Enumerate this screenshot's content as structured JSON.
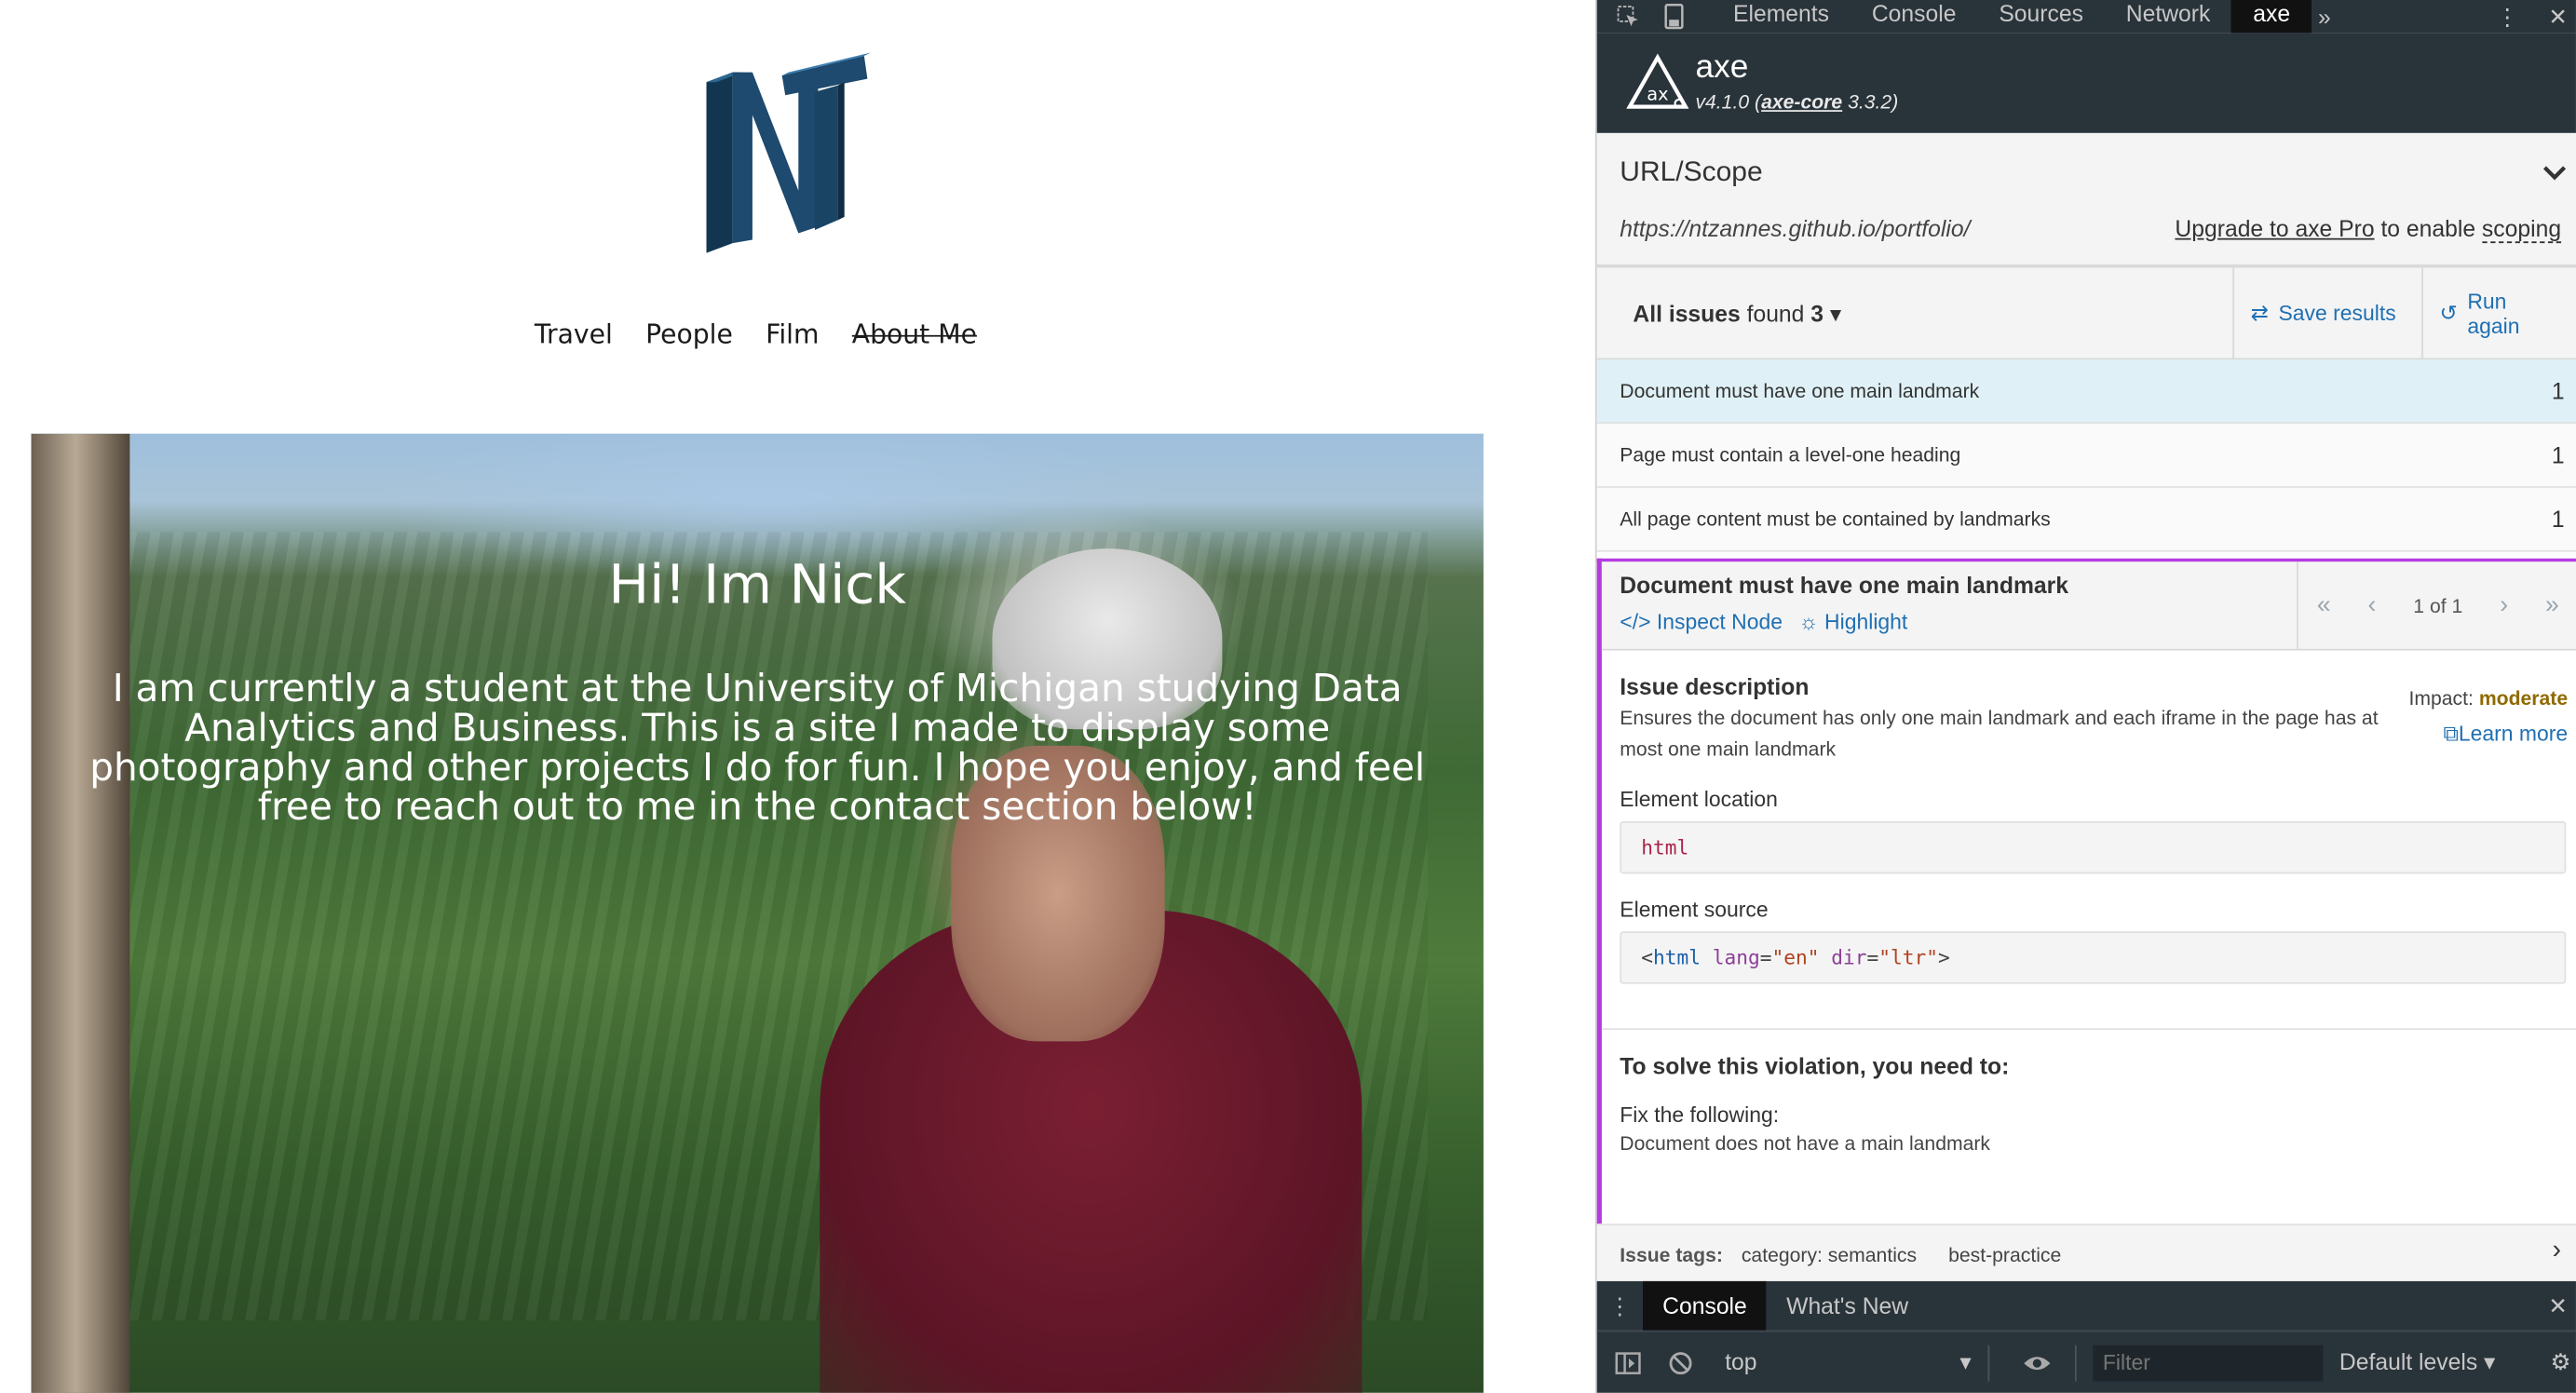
{
  "site": {
    "nav": [
      "Travel",
      "People",
      "Film",
      "About Me"
    ],
    "hero_title": "Hi! Im Nick",
    "hero_text": "I am currently a student at the University of Michigan studying Data Analytics and Business. This is a site I made to display some photography and other projects I do for fun. I hope you enjoy, and feel free to reach out to me in the contact section below!",
    "logo_letters": "NT",
    "logo_color": "#1d4a6e"
  },
  "devtools": {
    "tabs": [
      "Elements",
      "Console",
      "Sources",
      "Network",
      "axe"
    ],
    "active_tab": "axe",
    "icons": [
      "inspect-element-icon",
      "device-toolbar-icon",
      "more-tabs-icon",
      "kebab-menu-icon",
      "close-icon"
    ],
    "axe": {
      "name": "axe",
      "version": "v4.1.0",
      "core_label": "axe-core",
      "core_version": "3.3.2",
      "scope_title": "URL/Scope",
      "url": "https://ntzannes.github.io/portfolio/",
      "upgrade_link": "Upgrade to axe Pro",
      "upgrade_rest": "to enable",
      "upgrade_scoping": "scoping",
      "issues_label": "All issues",
      "issues_found": "found",
      "issues_count": "3",
      "save_results": "Save results",
      "run_again": "Run again",
      "issues": [
        {
          "label": "Document must have one main landmark",
          "count": "1",
          "selected": true
        },
        {
          "label": "Page must contain a level-one heading",
          "count": "1",
          "selected": false
        },
        {
          "label": "All page content must be contained by landmarks",
          "count": "1",
          "selected": false
        }
      ],
      "detail": {
        "title": "Document must have one main landmark",
        "inspect_node": "Inspect Node",
        "highlight": "Highlight",
        "pager": "1 of 1",
        "issue_description_title": "Issue description",
        "issue_description": "Ensures the document has only one main landmark and each iframe in the page has at most one main landmark",
        "impact_label": "Impact:",
        "impact_value": "moderate",
        "learn_more": "Learn more",
        "element_location_label": "Element location",
        "element_location": "html",
        "element_source_label": "Element source",
        "source_tag": "html",
        "source_attr1": "lang",
        "source_val1": "\"en\"",
        "source_attr2": "dir",
        "source_val2": "\"ltr\"",
        "solve_title": "To solve this violation, you need to:",
        "fix_label": "Fix the following:",
        "fix_item": "Document does not have a main landmark"
      },
      "tags_label": "Issue tags:",
      "tags": [
        "category: semantics",
        "best-practice"
      ]
    },
    "drawer": {
      "tabs": [
        "Console",
        "What's New"
      ],
      "active": "Console",
      "context": "top",
      "filter_placeholder": "Filter",
      "levels": "Default levels"
    },
    "colors": {
      "toolbar_bg": "#29333a",
      "link": "#1f6fb2",
      "selected_row": "#dff1f6",
      "detail_border": "#b43be0",
      "impact": "#8f6a00"
    }
  }
}
